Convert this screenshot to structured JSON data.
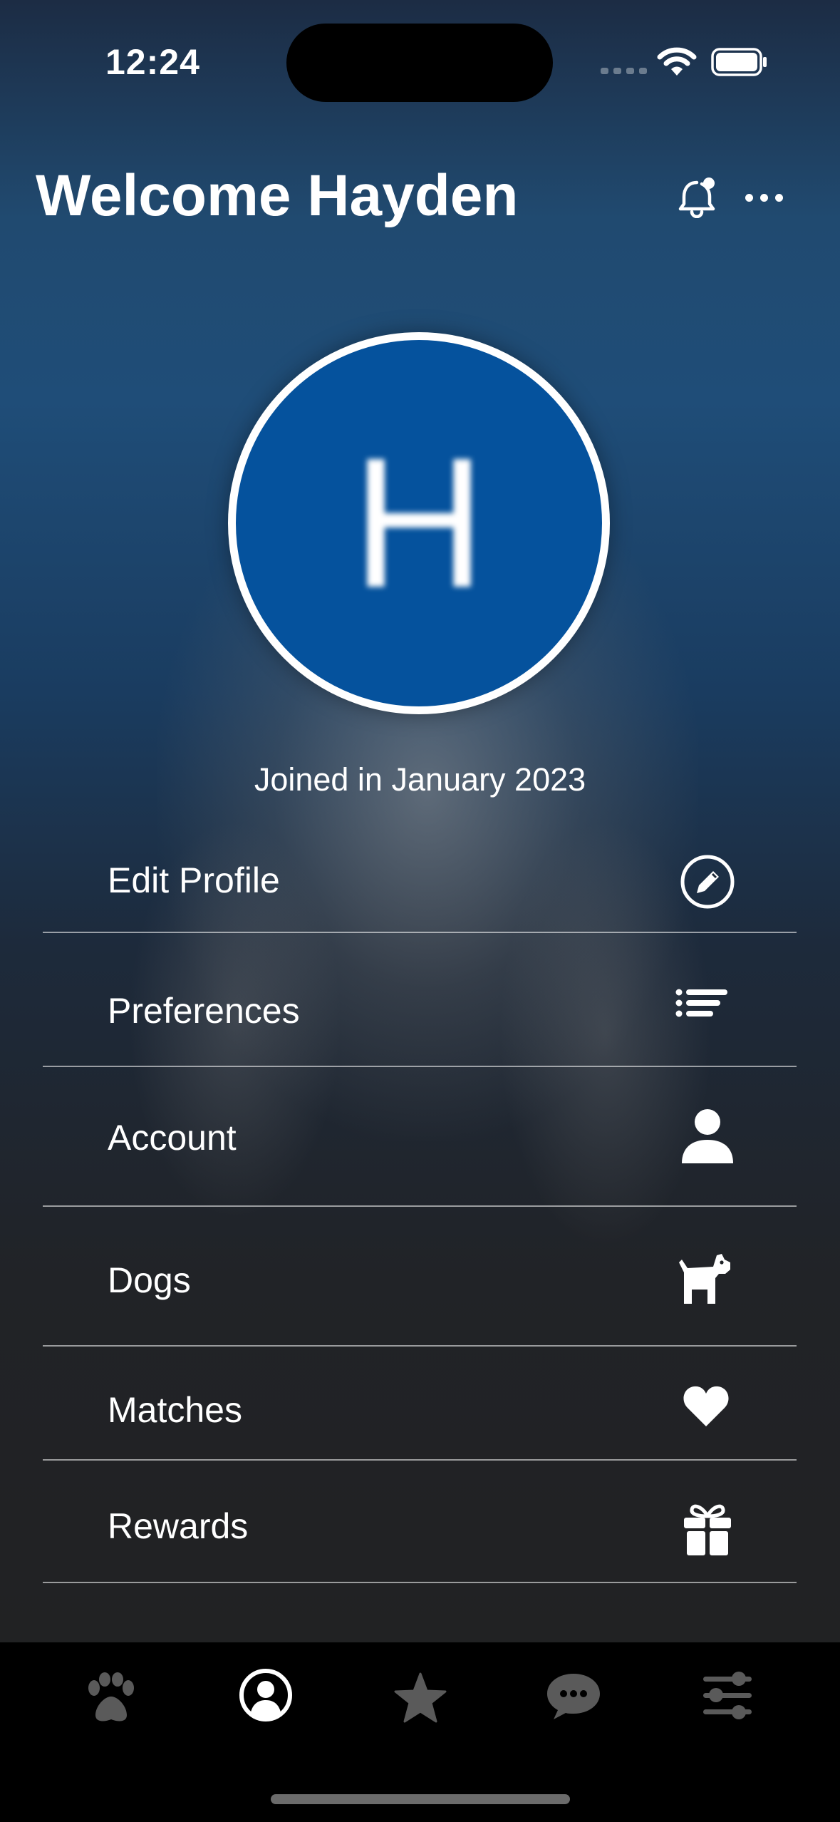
{
  "status_bar": {
    "time": "12:24"
  },
  "header": {
    "title": "Welcome Hayden",
    "notification_icon": "bell-badge-icon",
    "more_icon": "ellipsis-icon"
  },
  "profile": {
    "avatar_initial": "H",
    "avatar_color": "#05529d",
    "joined_text": "Joined in January 2023"
  },
  "menu": {
    "items": [
      {
        "label": "Edit Profile",
        "icon": "pencil-circle-icon"
      },
      {
        "label": "Preferences",
        "icon": "list-icon"
      },
      {
        "label": "Account",
        "icon": "person-icon"
      },
      {
        "label": "Dogs",
        "icon": "dog-icon"
      },
      {
        "label": "Matches",
        "icon": "heart-icon"
      },
      {
        "label": "Rewards",
        "icon": "gift-icon"
      }
    ]
  },
  "tabbar": {
    "tabs": [
      {
        "icon": "paw-icon",
        "active": false
      },
      {
        "icon": "profile-circle-icon",
        "active": true
      },
      {
        "icon": "star-icon",
        "active": false
      },
      {
        "icon": "chat-bubble-icon",
        "active": false
      },
      {
        "icon": "sliders-icon",
        "active": false
      }
    ],
    "active_color": "#ffffff",
    "inactive_color": "#5a5a5a"
  }
}
